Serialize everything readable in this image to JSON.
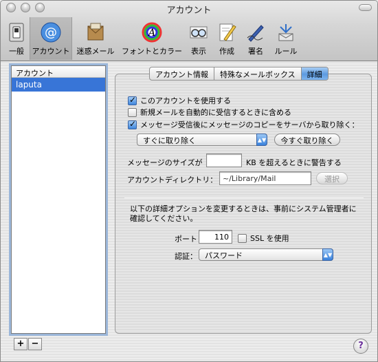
{
  "window": {
    "title": "アカウント"
  },
  "toolbar": {
    "items": [
      {
        "label": "一般",
        "icon": "general-switch-icon"
      },
      {
        "label": "アカウント",
        "icon": "at-sign-icon"
      },
      {
        "label": "迷惑メール",
        "icon": "junk-mail-icon"
      },
      {
        "label": "フォントとカラー",
        "icon": "color-letter-icon"
      },
      {
        "label": "表示",
        "icon": "view-glasses-icon"
      },
      {
        "label": "作成",
        "icon": "compose-pencil-icon"
      },
      {
        "label": "署名",
        "icon": "signature-pen-icon"
      },
      {
        "label": "ルール",
        "icon": "rules-icon"
      }
    ]
  },
  "accounts": {
    "header": "アカウント",
    "items": [
      "laputa"
    ]
  },
  "tabs": [
    "アカウント情報",
    "特殊なメールボックス",
    "詳細"
  ],
  "advanced": {
    "enable_account": "このアカウントを使用する",
    "include_new_mail": "新規メールを自動的に受信するときに含める",
    "remove_copy": "メッセージ受信後にメッセージのコピーをサーバから取り除く：",
    "remove_when": "すぐに取り除く",
    "remove_now": "今すぐ取り除く",
    "size_label": "メッセージのサイズが",
    "size_value": "",
    "size_suffix": "KB を超えるときに警告する",
    "dir_label": "アカウントディレクトリ：",
    "dir_value": "~/Library/Mail",
    "choose": "選択",
    "notice": "以下の詳細オプションを変更するときは、事前にシステム管理者に確認してください。",
    "port_label": "ポート：",
    "port_value": "110",
    "ssl": "SSL を使用",
    "auth_label": "認証：",
    "auth_value": "パスワード"
  },
  "buttons": {
    "add": "+",
    "remove": "−",
    "help": "?"
  },
  "colors": {
    "selection": "#3875d7",
    "accent": "#5c9ae0"
  }
}
